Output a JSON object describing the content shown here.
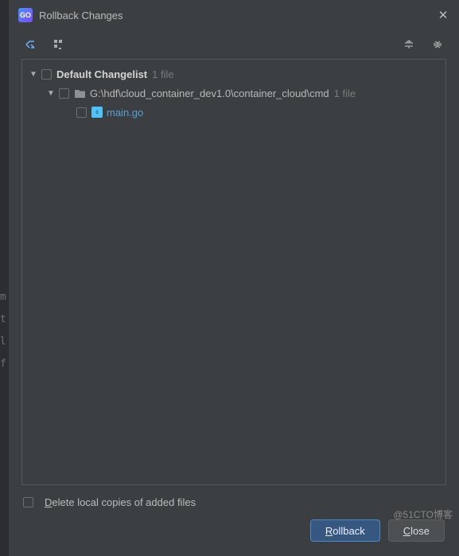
{
  "bg_gutter": [
    "m",
    "t",
    "l",
    "f"
  ],
  "dialog": {
    "app_icon_text": "GO",
    "title": "Rollback Changes"
  },
  "tree": {
    "changelist_label": "Default Changelist",
    "changelist_count": "1 file",
    "folder_path": "G:\\hdf\\cloud_container_dev1.0\\container_cloud\\cmd",
    "folder_count": "1 file",
    "file_name": "main.go"
  },
  "option": {
    "delete_label": "Delete local copies of added files"
  },
  "buttons": {
    "rollback": "Rollback",
    "close": "Close"
  },
  "watermark": "@51CTO博客"
}
